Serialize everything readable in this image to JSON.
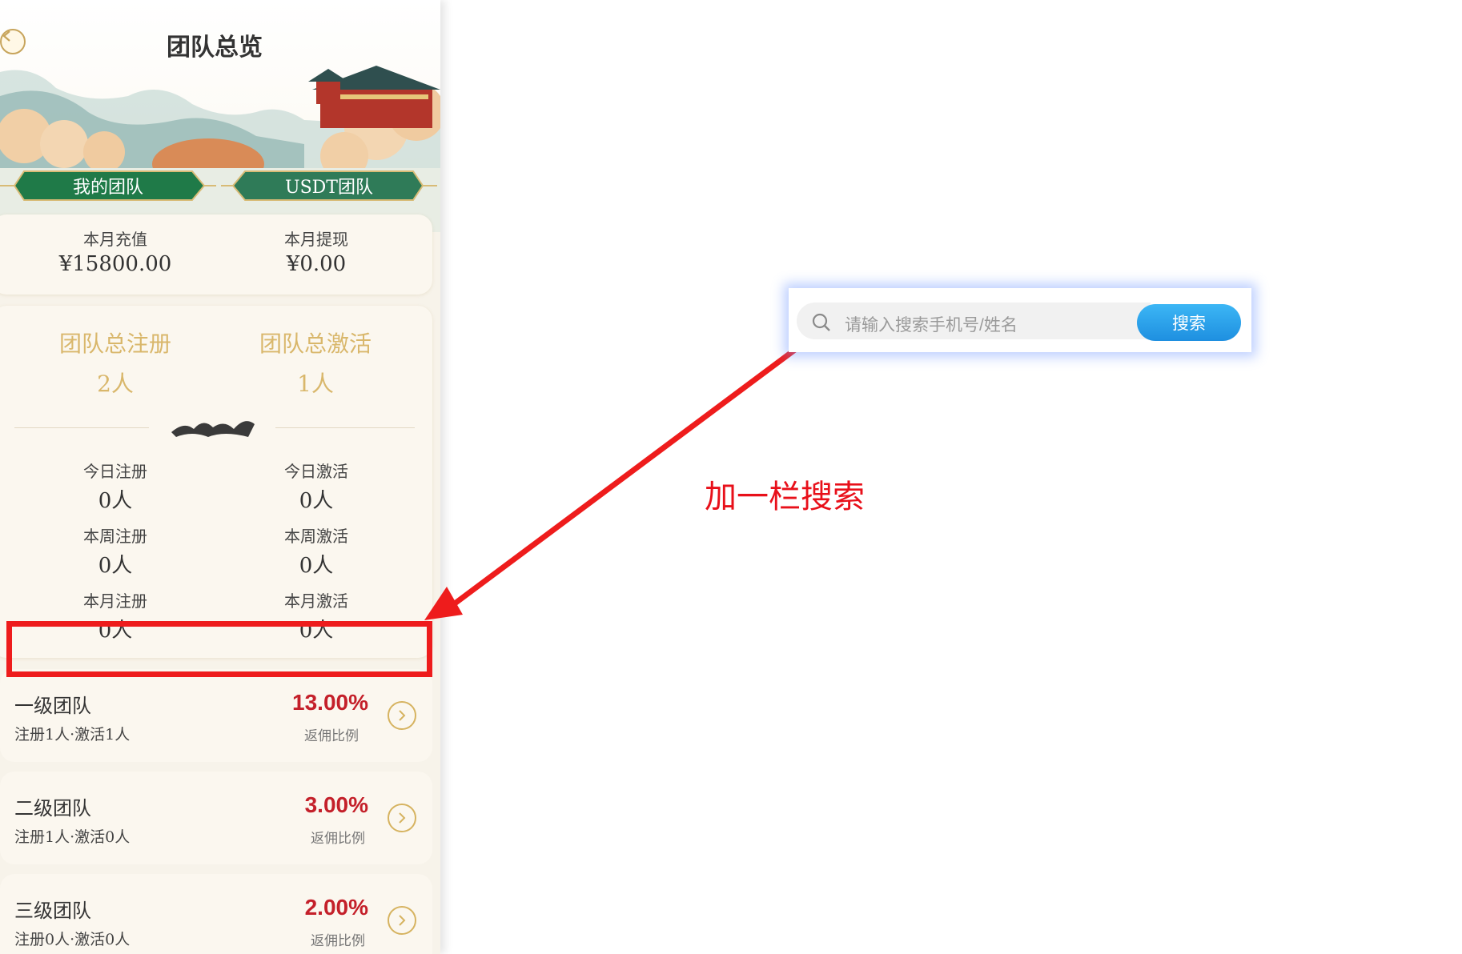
{
  "header": {
    "title": "团队总览"
  },
  "tabs": [
    {
      "label": "我的团队",
      "active": true
    },
    {
      "label": "USDT团队",
      "active": false
    }
  ],
  "monthly": {
    "recharge_label": "本月充值",
    "recharge_value": "¥15800.00",
    "withdraw_label": "本月提现",
    "withdraw_value": "¥0.00"
  },
  "totals": {
    "register_label": "团队总注册",
    "register_value": "2人",
    "activate_label": "团队总激活",
    "activate_value": "1人"
  },
  "periods": [
    {
      "reg_label": "今日注册",
      "reg_value": "0人",
      "act_label": "今日激活",
      "act_value": "0人"
    },
    {
      "reg_label": "本周注册",
      "reg_value": "0人",
      "act_label": "本周激活",
      "act_value": "0人"
    },
    {
      "reg_label": "本月注册",
      "reg_value": "0人",
      "act_label": "本月激活",
      "act_value": "0人"
    }
  ],
  "levels": [
    {
      "name": "一级团队",
      "sub": "注册1人·激活1人",
      "rate": "13.00%",
      "rate_label": "返佣比例"
    },
    {
      "name": "二级团队",
      "sub": "注册1人·激活0人",
      "rate": "3.00%",
      "rate_label": "返佣比例"
    },
    {
      "name": "三级团队",
      "sub": "注册0人·激活0人",
      "rate": "2.00%",
      "rate_label": "返佣比例"
    }
  ],
  "search": {
    "placeholder": "请输入搜索手机号/姓名",
    "button_label": "搜索"
  },
  "annotation": {
    "text": "加一栏搜索",
    "color": "#e8101a"
  },
  "colors": {
    "accent_green": "#1f7a48",
    "gold": "#d9b76b",
    "rate_red": "#c4202a",
    "search_blue": "#2a9eea"
  }
}
